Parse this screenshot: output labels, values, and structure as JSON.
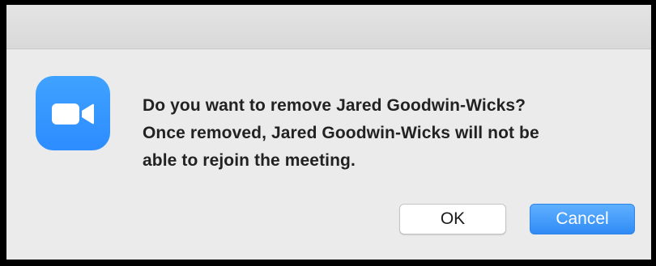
{
  "dialog": {
    "message_line1": "Do you want to remove Jared Goodwin-Wicks?",
    "message_line2": "Once removed, Jared Goodwin-Wicks will not be",
    "message_line3": "able to rejoin the meeting.",
    "app_icon": "zoom-video-camera-icon",
    "accent_color": "#2d8cff"
  },
  "buttons": {
    "ok_label": "OK",
    "cancel_label": "Cancel"
  }
}
